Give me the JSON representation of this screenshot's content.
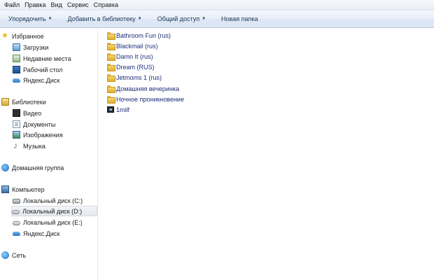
{
  "menu": [
    "Файл",
    "Правка",
    "Вид",
    "Сервис",
    "Справка"
  ],
  "toolbar": {
    "organize": "Упорядочить",
    "add_to_library": "Добавить в библиотеку",
    "share": "Общий доступ",
    "new_folder": "Новая папка"
  },
  "nav": {
    "favorites": "Избранное",
    "downloads": "Загрузки",
    "recent": "Недавние места",
    "desktop": "Рабочий стол",
    "yandex_disk_fav": "Яндекс.Диск",
    "libraries": "Библиотеки",
    "video": "Видео",
    "documents": "Документы",
    "images": "Изображения",
    "music": "Музыка",
    "homegroup": "Домашняя группа",
    "computer": "Компьютер",
    "disk_c": "Локальный диск (C:)",
    "disk_d": "Локальный диск (D:)",
    "disk_e": "Локальный диск (E:)",
    "yandex_disk_comp": "Яндекс.Диск",
    "network": "Сеть"
  },
  "files": [
    {
      "name": "Bathroom Fun (rus)",
      "type": "folder"
    },
    {
      "name": "Blackmail (rus)",
      "type": "folder"
    },
    {
      "name": "Damn It (rus)",
      "type": "folder"
    },
    {
      "name": "Dream (RUS)",
      "type": "folder"
    },
    {
      "name": "Jetmoms 1 (rus)",
      "type": "folder"
    },
    {
      "name": "Домашняя вечеринка",
      "type": "folder"
    },
    {
      "name": "Ночное проникновение",
      "type": "folder"
    },
    {
      "name": "1milf",
      "type": "video"
    }
  ],
  "colors": {
    "link_text": "#1e2f7a",
    "toolbar_text": "#1e395b",
    "folder": "#f7d774"
  }
}
